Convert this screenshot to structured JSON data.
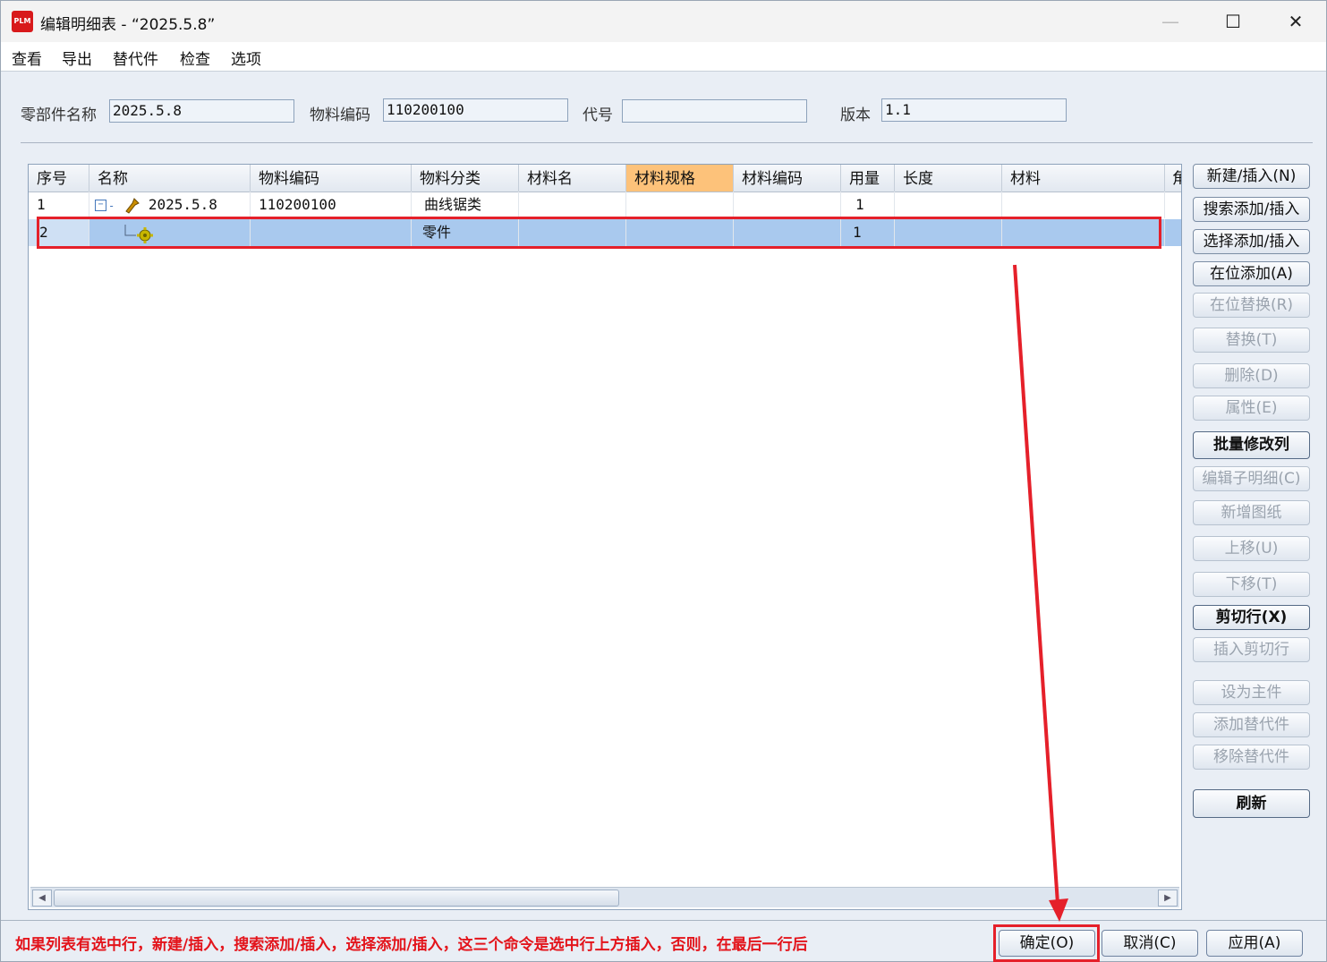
{
  "window": {
    "title": "编辑明细表 - “2025.5.8”",
    "app_icon_text": "PLM",
    "minimize": "—",
    "maximize": "☐",
    "close": "✕"
  },
  "menu": [
    "查看",
    "导出",
    "替代件",
    "检查",
    "选项"
  ],
  "form": {
    "part_name_label": "零部件名称",
    "part_name_value": "2025.5.8",
    "material_code_label": "物料编码",
    "material_code_value": "110200100",
    "code_label": "代号",
    "code_value": "",
    "version_label": "版本",
    "version_value": "1.1"
  },
  "table": {
    "columns": [
      "序号",
      "名称",
      "物料编码",
      "物料分类",
      "材料名",
      "材料规格",
      "材料编码",
      "用量",
      "长度",
      "材料",
      "角"
    ],
    "highlighted_column": "材料规格",
    "rows": [
      {
        "seq": "1",
        "name": "2025.5.8",
        "material_code": "110200100",
        "category": "曲线锯类",
        "material_name": "",
        "spec": "",
        "mat_code": "",
        "qty": "1",
        "length": "",
        "material": ""
      },
      {
        "seq": "2",
        "name": "",
        "material_code": "",
        "category": "零件",
        "material_name": "",
        "spec": "",
        "mat_code": "",
        "qty": "1",
        "length": "",
        "material": ""
      }
    ],
    "selected_row": 2
  },
  "side_buttons": [
    {
      "label": "新建/插入(N)",
      "enabled": true
    },
    {
      "label": "搜索添加/插入",
      "enabled": true
    },
    {
      "label": "选择添加/插入",
      "enabled": true
    },
    {
      "label": "在位添加(A)",
      "enabled": true
    },
    {
      "label": "在位替换(R)",
      "enabled": false
    },
    {
      "label": "替换(T)",
      "enabled": false
    },
    {
      "label": "删除(D)",
      "enabled": false
    },
    {
      "label": "属性(E)",
      "enabled": false
    },
    {
      "label": "批量修改列",
      "enabled": true
    },
    {
      "label": "编辑子明细(C)",
      "enabled": false
    },
    {
      "label": "新增图纸",
      "enabled": false
    },
    {
      "label": "上移(U)",
      "enabled": false
    },
    {
      "label": "下移(T)",
      "enabled": false
    },
    {
      "label": "剪切行(X)",
      "enabled": true
    },
    {
      "label": "插入剪切行",
      "enabled": false
    },
    {
      "label": "设为主件",
      "enabled": false
    },
    {
      "label": "添加替代件",
      "enabled": false
    },
    {
      "label": "移除替代件",
      "enabled": false
    },
    {
      "label": "刷新",
      "enabled": true
    }
  ],
  "hint": "如果列表有选中行，新建/插入，搜索添加/插入，选择添加/插入，这三个命令是选中行上方插入，否则，在最后一行后",
  "bottom_buttons": {
    "ok": "确定(O)",
    "cancel": "取消(C)",
    "apply": "应用(A)"
  },
  "colors": {
    "annotation": "#e5202a",
    "selected_row": "#a9c9ee",
    "highlight_column": "#fdc27a"
  }
}
